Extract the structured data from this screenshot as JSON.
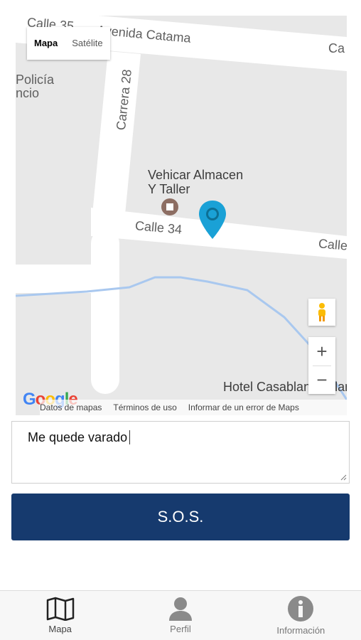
{
  "map": {
    "map_type": {
      "map_label": "Mapa",
      "satellite_label": "Satélite"
    },
    "labels": {
      "street_top": "Calle 35",
      "avenue_top": "Avenida Catama",
      "right_top": "Ca",
      "police_1": "Policía",
      "police_2": "ncio",
      "carrera": "Carrera 28",
      "business_1": "Vehicar Almacen",
      "business_2": "Y Taller",
      "calle34": "Calle 34",
      "calle_right": "Calle",
      "hotel": "Hotel Casablanca Llanero"
    },
    "zoom": {
      "in": "+",
      "out": "−"
    },
    "attribution": {
      "google": "Google",
      "map_data": "Datos de mapas",
      "terms": "Términos de uso",
      "report": "Informar de un error de Maps"
    },
    "colors": {
      "pin": "#1aa1d6",
      "road": "#ffffff",
      "water": "#a9c8ef",
      "poi": "#8d6e63"
    }
  },
  "message": {
    "value": "Me quede varado"
  },
  "sos": {
    "label": "S.O.S.",
    "color": "#163a6e"
  },
  "nav": {
    "items": [
      {
        "label": "Mapa",
        "icon": "map-icon"
      },
      {
        "label": "Perfil",
        "icon": "person-icon"
      },
      {
        "label": "Información",
        "icon": "info-icon"
      }
    ]
  }
}
